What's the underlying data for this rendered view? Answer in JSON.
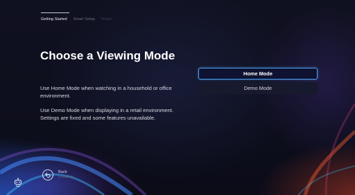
{
  "steps": [
    {
      "label": "Getting Started"
    },
    {
      "label": "Smart Setup"
    },
    {
      "label": "Finish"
    }
  ],
  "main": {
    "title": "Choose a Viewing Mode",
    "description_home": "Use Home Mode when watching in a household or office environment.",
    "description_demo": "Use Demo Mode when displaying in a retail environment. Settings are fixed and some features unavailable."
  },
  "options": [
    {
      "label": "Home Mode",
      "selected": true
    },
    {
      "label": "Demo Mode",
      "selected": false
    }
  ],
  "footer": {
    "back_label": "Back",
    "back_hint": "Location"
  },
  "icons": {
    "back": "back-arrow-icon",
    "mascot": "robot-icon"
  },
  "colors": {
    "focus": "#4fa3f5",
    "background": "#0e0f1e"
  }
}
